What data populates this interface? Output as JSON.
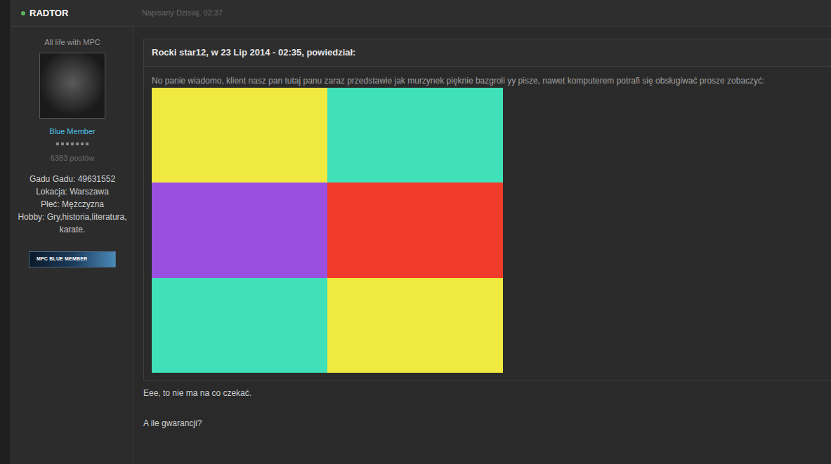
{
  "post": {
    "author": "RADTOR",
    "online": true,
    "posted": "Napisany Dzisiaj, 02:37"
  },
  "profile": {
    "title": "All life with MPC",
    "group": "Blue Member",
    "rank_pips": 7,
    "posts": "6383 postów",
    "fields": [
      {
        "label": "Gadu Gadu:",
        "value": "49631552"
      },
      {
        "label": "Lokacja:",
        "value": "Warszawa"
      },
      {
        "label": "Płeć:",
        "value": "Mężczyzna"
      },
      {
        "label": "Hobby:",
        "value": "Gry,historia,literatura,karate."
      }
    ],
    "badge": "MPC BLUE MEMBER"
  },
  "quote": {
    "header": "Rocki star12, w 23 Lip 2014 - 02:35, powiedział:",
    "text": "No panie wiadomo, klient nasz pan tutaj panu zaraz przedstawie jak murzynek pięknie bazgroli yy pisze, nawet komputerem potrafi się obsługiwać prosze zobaczyć:"
  },
  "body": [
    "Eee, to nie ma na co czekać.",
    "A ile gwarancji?"
  ]
}
